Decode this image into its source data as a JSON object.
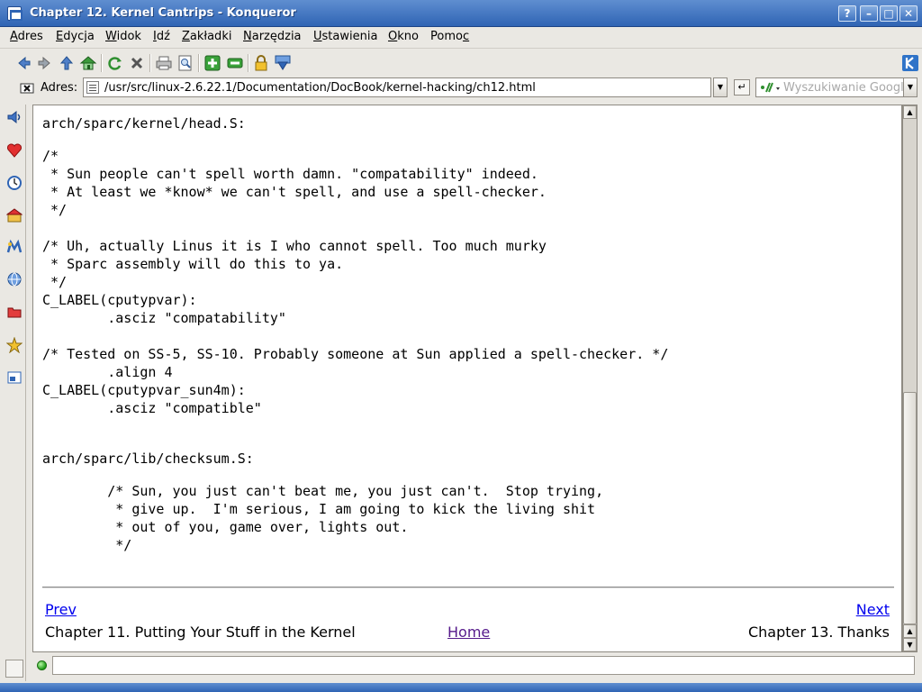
{
  "window": {
    "title": "Chapter 12. Kernel Cantrips - Konqueror",
    "buttons": {
      "help": "?",
      "minimize": "–",
      "maximize": "□",
      "close": "✕"
    }
  },
  "menu": [
    {
      "label": "Adres",
      "accel": "A",
      "rest": "dres"
    },
    {
      "label": "Edycja",
      "accel": "E",
      "rest": "dycja"
    },
    {
      "label": "Widok",
      "accel": "W",
      "rest": "idok"
    },
    {
      "label": "Idź",
      "accel": "I",
      "rest": "dź"
    },
    {
      "label": "Zakładki",
      "accel": "Z",
      "rest": "akładki"
    },
    {
      "label": "Narzędzia",
      "accel": "N",
      "rest": "arzędzia"
    },
    {
      "label": "Ustawienia",
      "accel": "U",
      "rest": "stawienia"
    },
    {
      "label": "Okno",
      "accel": "O",
      "rest": "kno"
    },
    {
      "label": "Pomoc",
      "pre": "Pomo",
      "accel": "c"
    }
  ],
  "toolbar": {
    "icons": [
      "back-icon",
      "forward-icon",
      "up-icon",
      "home-icon",
      "reload-icon",
      "stop-icon",
      "print-icon",
      "print-preview-icon",
      "zoom-in-icon",
      "zoom-out-icon",
      "security-lock-icon",
      "download-icon"
    ]
  },
  "address": {
    "label": "Adres:",
    "url": "/usr/src/linux-2.6.22.1/Documentation/DocBook/kernel-hacking/ch12.html",
    "search_placeholder": "Wyszukiwanie Google"
  },
  "sidebar": {
    "icons": [
      "media-player-icon",
      "bookmarks-icon",
      "history-icon",
      "home-folder-icon",
      "services-icon",
      "network-icon",
      "root-folder-icon",
      "favorites-icon",
      "devices-icon"
    ]
  },
  "content": {
    "code_blocks": [
      "arch/sparc/kernel/head.S:",
      "/*\n * Sun people can't spell worth damn. \"compatability\" indeed.\n * At least we *know* we can't spell, and use a spell-checker.\n */\n\n/* Uh, actually Linus it is I who cannot spell. Too much murky\n * Sparc assembly will do this to ya.\n */\nC_LABEL(cputypvar):\n        .asciz \"compatability\"\n\n/* Tested on SS-5, SS-10. Probably someone at Sun applied a spell-checker. */\n        .align 4\nC_LABEL(cputypvar_sun4m):\n        .asciz \"compatible\"",
      "arch/sparc/lib/checksum.S:",
      "        /* Sun, you just can't beat me, you just can't.  Stop trying,\n         * give up.  I'm serious, I am going to kick the living shit\n         * out of you, game over, lights out.\n         */"
    ],
    "nav": {
      "prev_label": "Prev",
      "next_label": "Next",
      "prev_title": "Chapter 11. Putting Your Stuff in the Kernel",
      "home_label": "Home",
      "next_title": "Chapter 13. Thanks"
    }
  },
  "status": {
    "text": ""
  },
  "colors": {
    "link": "#0000ee",
    "titlebar": "#3a6fc0",
    "visited": "#551a8b"
  }
}
